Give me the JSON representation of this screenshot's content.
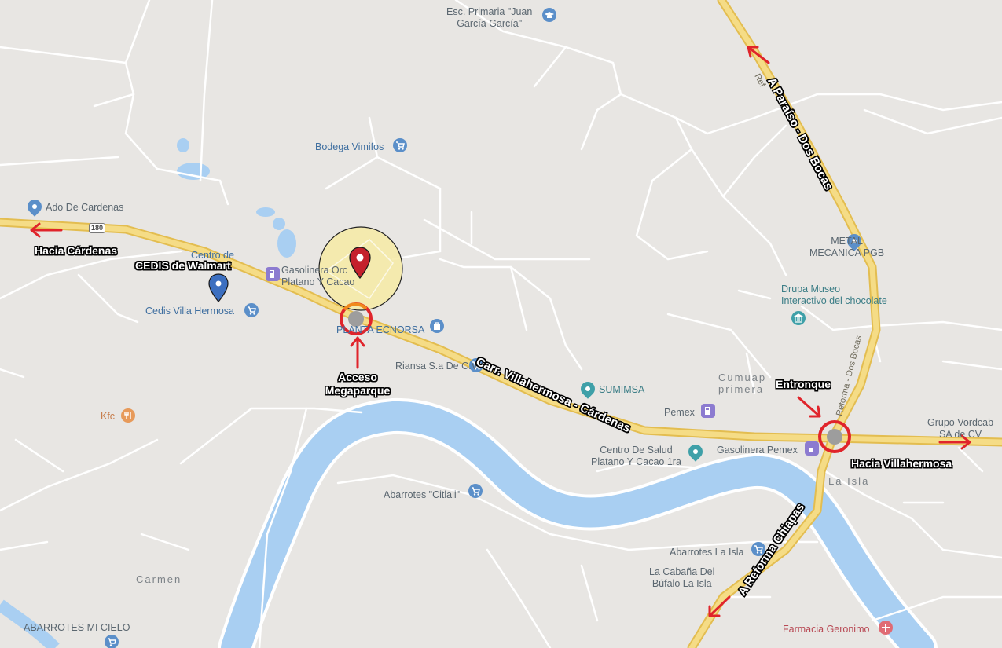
{
  "colors": {
    "background": "#e8e6e3",
    "road_major": "#f5dc86",
    "road_major_edge": "#e3bd50",
    "road_minor": "#ffffff",
    "water": "#a9cff2",
    "annotation_red": "#e0242b",
    "accent_orange": "#f08a1c",
    "area_highlight": "#f6eaa4",
    "poi_blue": "#5b8fc9",
    "poi_teal": "#3fa0a8",
    "poi_purple": "#8c7bd0",
    "poi_orange": "#e79a5a",
    "poi_red": "#e06b74"
  },
  "annotations": {
    "hacia_cardenas": "Hacia Cárdenas",
    "cedis_walmart": "CEDIS de Walmart",
    "acceso_line1": "Acceso",
    "acceso_line2": "Megaparque",
    "entronque": "Entronque",
    "hacia_villahermosa": "Hacia Villahermosa",
    "carr_label": "Carr. Villahermosa - Cárdenas",
    "paraiso_label": "A Paraíso - Dos Bocas",
    "reforma_label": "A Reforma Chiapas"
  },
  "places": {
    "escuela_line1": "Esc. Primaria \"Juan",
    "escuela_line2": "García García\"",
    "bodega": "Bodega Vimifos",
    "ado": "Ado De Cardenas",
    "centro_de_line1": "Centro de",
    "cedis_villa": "Cedis Villa Hermosa",
    "gasolinera_line1": "Gasolinera Orc",
    "gasolinera_line2": "Platano Y Cacao",
    "planta": "PLANTA ECNORSA",
    "riansa": "Riansa S.a De C.V",
    "metal_line1": "METAL",
    "metal_line2": "MECANICA PGB",
    "drupa_line1": "Drupa Museo",
    "drupa_line2": "Interactivo del chocolate",
    "cumuapa_line1": "Cumuap",
    "cumuapa_line2": "primera",
    "sumimsa": "SUMIMSA",
    "pemex": "Pemex",
    "kfc": "Kfc",
    "centro_salud_line1": "Centro De Salud",
    "centro_salud_line2": "Platano Y Cacao 1ra",
    "gasolinera_pemex": "Gasolinera Pemex",
    "grupo_line1": "Grupo Vordcab",
    "grupo_line2": "SA de CV",
    "la_isla": "La Isla",
    "abarrotes_citlali": "Abarrotes \"Citlali\"",
    "abarrotes_la_isla": "Abarrotes La Isla",
    "cabana_line1": "La Cabaña Del",
    "cabana_line2": "Búfalo La Isla",
    "carmen": "Carmen",
    "abarrotes_mi_cielo": "ABARROTES MI CIELO",
    "farmacia": "Farmacia Geronimo"
  },
  "road_labels": {
    "route_shield": "180",
    "reforma_dos_bocas_a": "Reforma - Dos Bocas",
    "reforma_dos_bocas_b": "Ref"
  },
  "icons": {
    "site_marker": "map-pin-icon",
    "walmart_marker": "map-pin-icon",
    "access_point": "circle-marker-icon",
    "junction_point": "circle-marker-icon",
    "shopping": "shopping-cart-icon",
    "school": "school-icon",
    "gas": "gas-station-icon",
    "museum": "museum-icon",
    "restaurant": "restaurant-icon",
    "health": "plus-icon",
    "location": "location-pin-icon"
  }
}
